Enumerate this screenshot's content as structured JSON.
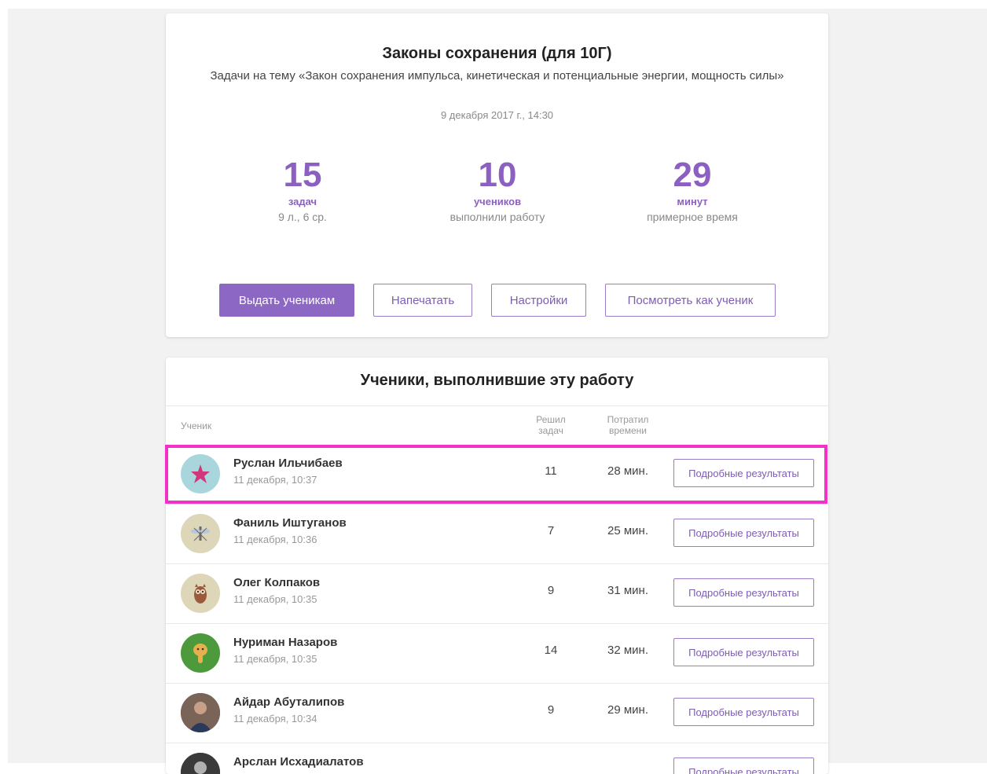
{
  "work": {
    "title": "Законы сохранения (для 10Г)",
    "subtitle": "Задачи на тему «Закон сохранения импульса, кинетическая и потенциальные энергии, мощность силы»",
    "date": "9 декабря 2017 г., 14:30"
  },
  "stats": [
    {
      "value": "15",
      "unit": "задач",
      "desc": "9 л., 6 ср."
    },
    {
      "value": "10",
      "unit": "учеников",
      "desc": "выполнили работу"
    },
    {
      "value": "29",
      "unit": "минут",
      "desc": "примерное время"
    }
  ],
  "actions": {
    "assign": "Выдать ученикам",
    "print": "Напечатать",
    "settings": "Настройки",
    "preview": "Посмотреть как ученик"
  },
  "students_section": {
    "title": "Ученики, выполнившие эту работу",
    "col_student": "Ученик",
    "col_solved_1": "Решил",
    "col_solved_2": "задач",
    "col_time_1": "Потратил",
    "col_time_2": "времени",
    "details_label": "Подробные результаты"
  },
  "students": [
    {
      "name": "Руслан Ильчибаев",
      "time": "11 декабря, 10:37",
      "solved": "11",
      "spent": "28 мин.",
      "avatar_icon": "star-icon",
      "avatar_color": "#a9d6dc"
    },
    {
      "name": "Фаниль Иштуганов",
      "time": "11 декабря, 10:36",
      "solved": "7",
      "spent": "25 мин.",
      "avatar_icon": "mosquito-icon",
      "avatar_color": "#ddd6b8"
    },
    {
      "name": "Олег Колпаков",
      "time": "11 декабря, 10:35",
      "solved": "9",
      "spent": "31 мин.",
      "avatar_icon": "owl-icon",
      "avatar_color": "#ddd6b8"
    },
    {
      "name": "Нуриман Назаров",
      "time": "11 декабря, 10:35",
      "solved": "14",
      "spent": "32 мин.",
      "avatar_icon": "cobra-icon",
      "avatar_color": "#4c9a3c"
    },
    {
      "name": "Айдар Абуталипов",
      "time": "11 декабря, 10:34",
      "solved": "9",
      "spent": "29 мин.",
      "avatar_icon": "photo-avatar-icon",
      "avatar_color": "#5a4a42"
    },
    {
      "name": "Арслан Исхадиалатов",
      "time": "",
      "solved": "",
      "spent": "",
      "avatar_icon": "photo-avatar-icon",
      "avatar_color": "#3a3a3a"
    }
  ],
  "colors": {
    "accent": "#8c60c0",
    "highlight": "#f032c8"
  }
}
